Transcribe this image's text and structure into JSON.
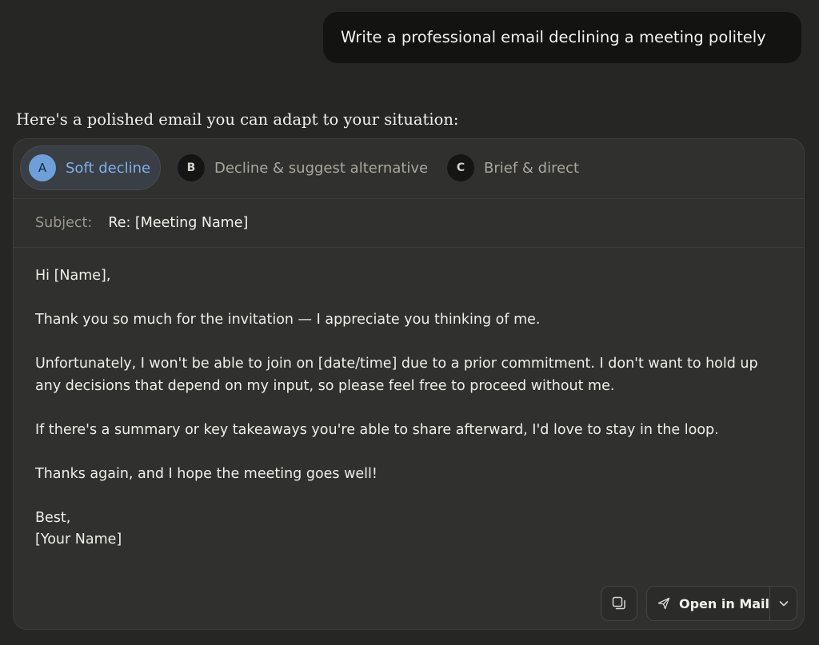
{
  "conversation": {
    "user_message": "Write a professional email declining a meeting politely",
    "assistant_intro": "Here's a polished email you can adapt to your situation:"
  },
  "variants": [
    {
      "badge": "A",
      "label": "Soft decline",
      "active": true
    },
    {
      "badge": "B",
      "label": "Decline & suggest alternative",
      "active": false
    },
    {
      "badge": "C",
      "label": "Brief & direct",
      "active": false
    }
  ],
  "email": {
    "subject_label": "Subject:",
    "subject": "Re: [Meeting Name]",
    "greeting": "Hi [Name],",
    "paragraphs": [
      "Thank you so much for the invitation — I appreciate you thinking of me.",
      "Unfortunately, I won't be able to join on [date/time] due to a prior commitment. I don't want to hold up any decisions that depend on my input, so please feel free to proceed without me.",
      "If there's a summary or key takeaways you're able to share afterward, I'd love to stay in the loop.",
      "Thanks again, and I hope the meeting goes well!"
    ],
    "signoff": "Best,",
    "signature": "[Your Name]"
  },
  "actions": {
    "copy_icon": "copy-icon",
    "open_in_mail_label": "Open in Mail",
    "send_icon": "paper-plane-icon",
    "dropdown_icon": "chevron-down-icon"
  },
  "colors": {
    "background": "#262624",
    "card": "#30302e",
    "accent": "#7fb1ea"
  }
}
